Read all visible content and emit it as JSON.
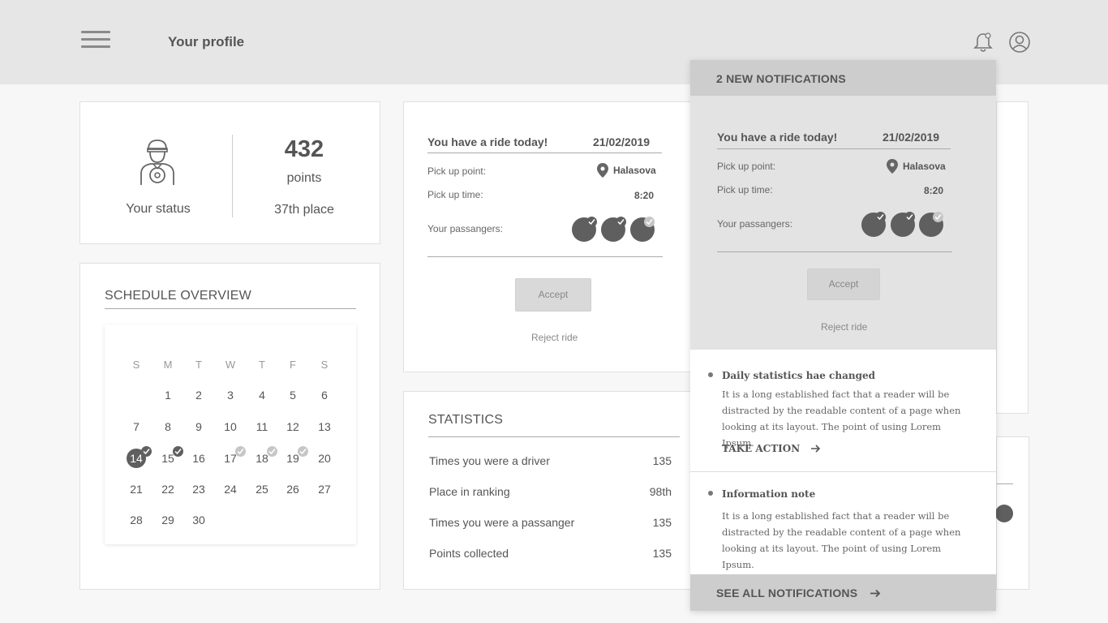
{
  "header": {
    "title": "Your profile"
  },
  "status": {
    "label": "Your status",
    "points": "432",
    "points_label": "points",
    "place": "37th place"
  },
  "schedule": {
    "title": "SCHEDULE OVERVIEW",
    "weekdays": [
      "S",
      "M",
      "T",
      "W",
      "T",
      "F",
      "S"
    ],
    "days": [
      "1",
      "2",
      "3",
      "4",
      "5",
      "6",
      "7",
      "8",
      "9",
      "10",
      "11",
      "12",
      "13",
      "14",
      "15",
      "16",
      "17",
      "18",
      "19",
      "20",
      "21",
      "22",
      "23",
      "24",
      "25",
      "26",
      "27",
      "28",
      "29",
      "30"
    ],
    "today": "14"
  },
  "ride": {
    "heading": "You have a ride today!",
    "date": "21/02/2019",
    "pickup_point_label": "Pick up point:",
    "pickup_point": "Halasova",
    "pickup_time_label": "Pick up time:",
    "pickup_time": "8:20",
    "passengers_label": "Your passangers:",
    "accept": "Accept",
    "reject": "Reject ride"
  },
  "statistics": {
    "title": "STATISTICS",
    "rows": [
      {
        "label": "Times you were a driver",
        "value": "135"
      },
      {
        "label": "Place in ranking",
        "value": "98th"
      },
      {
        "label": "Times you were a passanger",
        "value": "135"
      },
      {
        "label": "Points collected",
        "value": "135"
      }
    ]
  },
  "notifications": {
    "header": "2 NEW NOTIFICATIONS",
    "items": [
      {
        "title": "Daily statistics hae changed",
        "body": "It is a long established fact that a reader will be distracted by the readable content of a page when looking at its layout. The point of using Lorem Ipsum.",
        "action": "TAKE ACTION"
      },
      {
        "title": "Information note",
        "body": "It is a long established fact that a reader will be distracted by the readable content of a page when looking at its layout. The point of using Lorem Ipsum."
      }
    ],
    "footer": "SEE ALL NOTIFICATIONS"
  },
  "colors": {
    "header_bg": "#e6e6e6",
    "accent_dark": "#5f5f5f",
    "check_light": "#c6c6c6"
  }
}
